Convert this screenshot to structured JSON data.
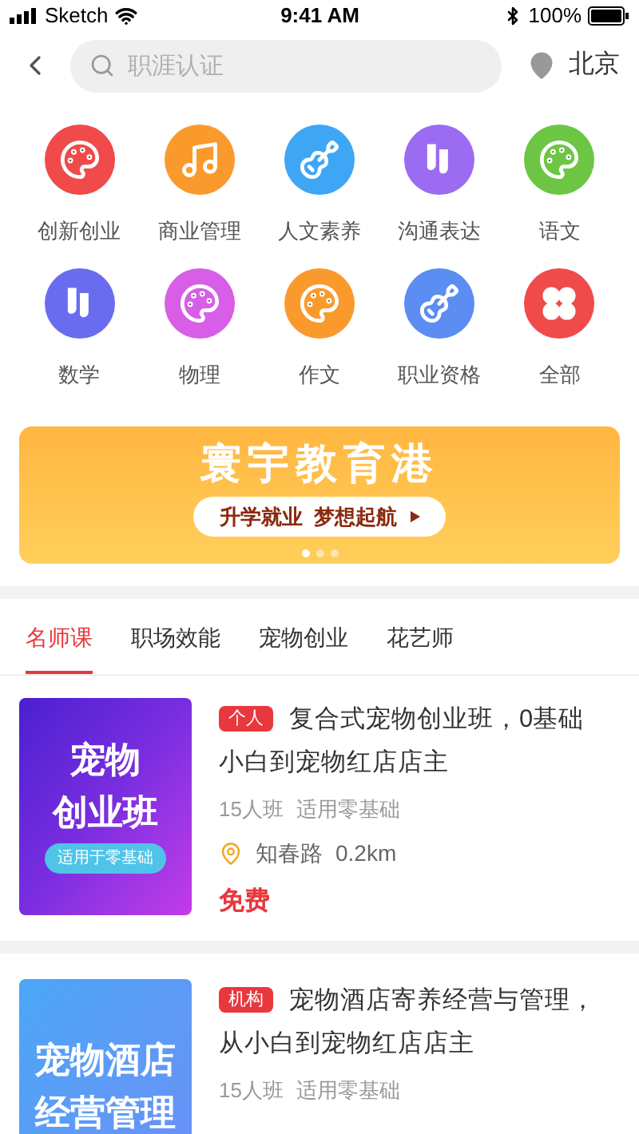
{
  "status_bar": {
    "carrier": "Sketch",
    "time": "9:41 AM",
    "battery": "100%"
  },
  "search": {
    "placeholder": "职涯认证"
  },
  "location": {
    "city": "北京"
  },
  "categories": [
    {
      "label": "创新创业",
      "kind": "palette",
      "color": "#f04a4a"
    },
    {
      "label": "商业管理",
      "kind": "music",
      "color": "#fb9a2c"
    },
    {
      "label": "人文素养",
      "kind": "guitar",
      "color": "#3ea6f5"
    },
    {
      "label": "沟通表达",
      "kind": "ballet",
      "color": "#9b6cf2"
    },
    {
      "label": "语文",
      "kind": "palette",
      "color": "#6cc644"
    },
    {
      "label": "数学",
      "kind": "ballet",
      "color": "#6a6cf0"
    },
    {
      "label": "物理",
      "kind": "palette",
      "color": "#d85ee8"
    },
    {
      "label": "作文",
      "kind": "palette",
      "color": "#fb9a2c"
    },
    {
      "label": "职业资格",
      "kind": "guitar",
      "color": "#5b8df2"
    },
    {
      "label": "全部",
      "kind": "clover",
      "color": "#f04a4a"
    }
  ],
  "banner": {
    "title": "寰宇教育港",
    "slogan": "升学就业  梦想起航",
    "dots": [
      {
        "selected": true
      },
      {
        "selected": false
      },
      {
        "selected": false
      }
    ]
  },
  "tabs": [
    {
      "label": "名师课",
      "selected": true
    },
    {
      "label": "职场效能",
      "selected": false
    },
    {
      "label": "宠物创业",
      "selected": false
    },
    {
      "label": "花艺师",
      "selected": false
    }
  ],
  "courses": [
    {
      "thumbnail": {
        "kind": "purple",
        "title_lines": [
          "宠物",
          "创业班"
        ],
        "tag": "适用于零基础"
      },
      "badge": "个人",
      "title": "复合式宠物创业班，0基础小白到宠物红店店主",
      "size": "15人班",
      "level": "适用零基础",
      "address": "知春路",
      "distance": "0.2km",
      "price": "免费"
    },
    {
      "thumbnail": {
        "kind": "blue",
        "title_lines": [
          "宠物酒店",
          "经营管理"
        ]
      },
      "badge": "机构",
      "title": "宠物酒店寄养经营与管理，从小白到宠物红店店主",
      "size": "15人班",
      "level": "适用零基础"
    }
  ]
}
